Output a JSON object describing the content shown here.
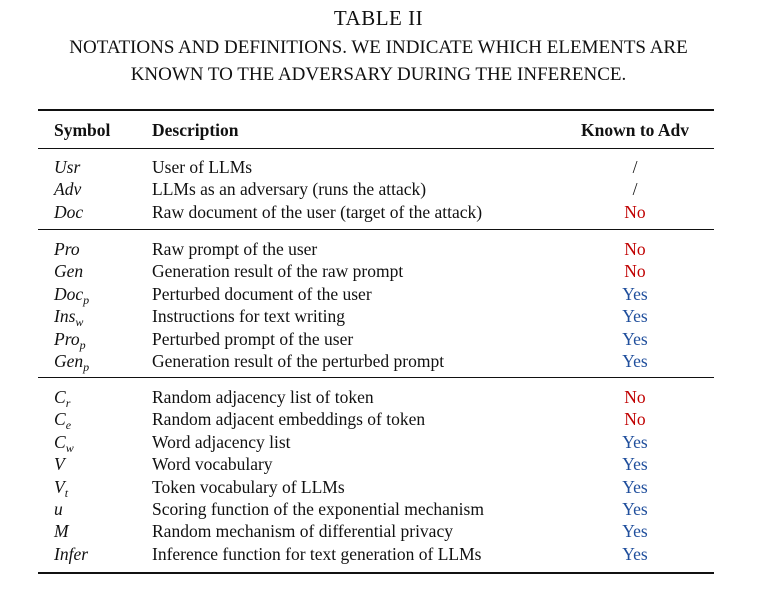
{
  "caption": {
    "line1": "TABLE II",
    "line2": "NOTATIONS AND DEFINITIONS. WE INDICATE WHICH ELEMENTS ARE",
    "line3": "KNOWN TO THE ADVERSARY DURING THE INFERENCE."
  },
  "header": {
    "symbol": "Symbol",
    "description": "Description",
    "known": "Known to Adv"
  },
  "colors": {
    "no": "#c00000",
    "yes": "#1f4e9c"
  },
  "groups": [
    [
      {
        "sym": "Usr",
        "sub": "",
        "desc": "User of LLMs",
        "known": "/",
        "kind": "chk"
      },
      {
        "sym": "Adv",
        "sub": "",
        "desc": "LLMs as an adversary (runs the attack)",
        "known": "/",
        "kind": "chk"
      },
      {
        "sym": "Doc",
        "sub": "",
        "desc": "Raw document of the user (target of the attack)",
        "known": "No",
        "kind": "no"
      }
    ],
    [
      {
        "sym": "Pro",
        "sub": "",
        "desc": "Raw prompt of the user",
        "known": "No",
        "kind": "no"
      },
      {
        "sym": "Gen",
        "sub": "",
        "desc": "Generation result of the raw prompt",
        "known": "No",
        "kind": "no"
      },
      {
        "sym": "Doc",
        "sub": "p",
        "desc": "Perturbed document of the user",
        "known": "Yes",
        "kind": "yes"
      },
      {
        "sym": "Ins",
        "sub": "w",
        "desc": "Instructions for text writing",
        "known": "Yes",
        "kind": "yes"
      },
      {
        "sym": "Pro",
        "sub": "p",
        "desc": "Perturbed prompt of the user",
        "known": "Yes",
        "kind": "yes"
      },
      {
        "sym": "Gen",
        "sub": "p",
        "desc": "Generation result of the perturbed prompt",
        "known": "Yes",
        "kind": "yes"
      }
    ],
    [
      {
        "sym": "C",
        "sub": "r",
        "desc": "Random adjacency list of token",
        "known": "No",
        "kind": "no"
      },
      {
        "sym": "C",
        "sub": "e",
        "desc": "Random adjacent embeddings of token",
        "known": "No",
        "kind": "no"
      },
      {
        "sym": "C",
        "sub": "w",
        "desc": "Word adjacency list",
        "known": "Yes",
        "kind": "yes"
      },
      {
        "sym": "V",
        "sub": "",
        "desc": "Word vocabulary",
        "known": "Yes",
        "kind": "yes"
      },
      {
        "sym": "V",
        "sub": "t",
        "desc": "Token vocabulary of LLMs",
        "known": "Yes",
        "kind": "yes"
      },
      {
        "sym": "u",
        "sub": "",
        "desc": "Scoring function of the exponential mechanism",
        "known": "Yes",
        "kind": "yes"
      },
      {
        "sym": "M",
        "sub": "",
        "desc": "Random mechanism of differential privacy",
        "known": "Yes",
        "kind": "yes"
      },
      {
        "sym": "Infer",
        "sub": "",
        "desc": "Inference function for text generation of LLMs",
        "known": "Yes",
        "kind": "yes"
      }
    ]
  ]
}
